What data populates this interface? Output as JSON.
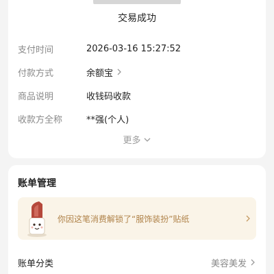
{
  "transaction": {
    "status": "交易成功",
    "details": [
      {
        "label": "支付时间",
        "value": "2026-03-16 15:27:52"
      },
      {
        "label": "付款方式",
        "value": "余额宝"
      },
      {
        "label": "商品说明",
        "value": "收钱码收款"
      },
      {
        "label": "收款方全称",
        "value": "**强(个人)"
      }
    ],
    "more_label": "更多"
  },
  "bill_management": {
    "title": "账单管理",
    "sticker_banner": {
      "text": "你因这笔消费解锁了“服饰装扮”贴纸"
    },
    "category": {
      "label": "账单分类",
      "value": "美容美发"
    }
  },
  "icons": {
    "chevron_right": "chevron-right-icon",
    "chevron_down": "chevron-down-icon",
    "sticker": "lipstick-sticker-icon"
  },
  "colors": {
    "background": "#f4f4f4",
    "card": "#ffffff",
    "banner_bg": "#faf4e8",
    "banner_text": "#b0834a",
    "secondary_text": "#8a8a8a"
  }
}
